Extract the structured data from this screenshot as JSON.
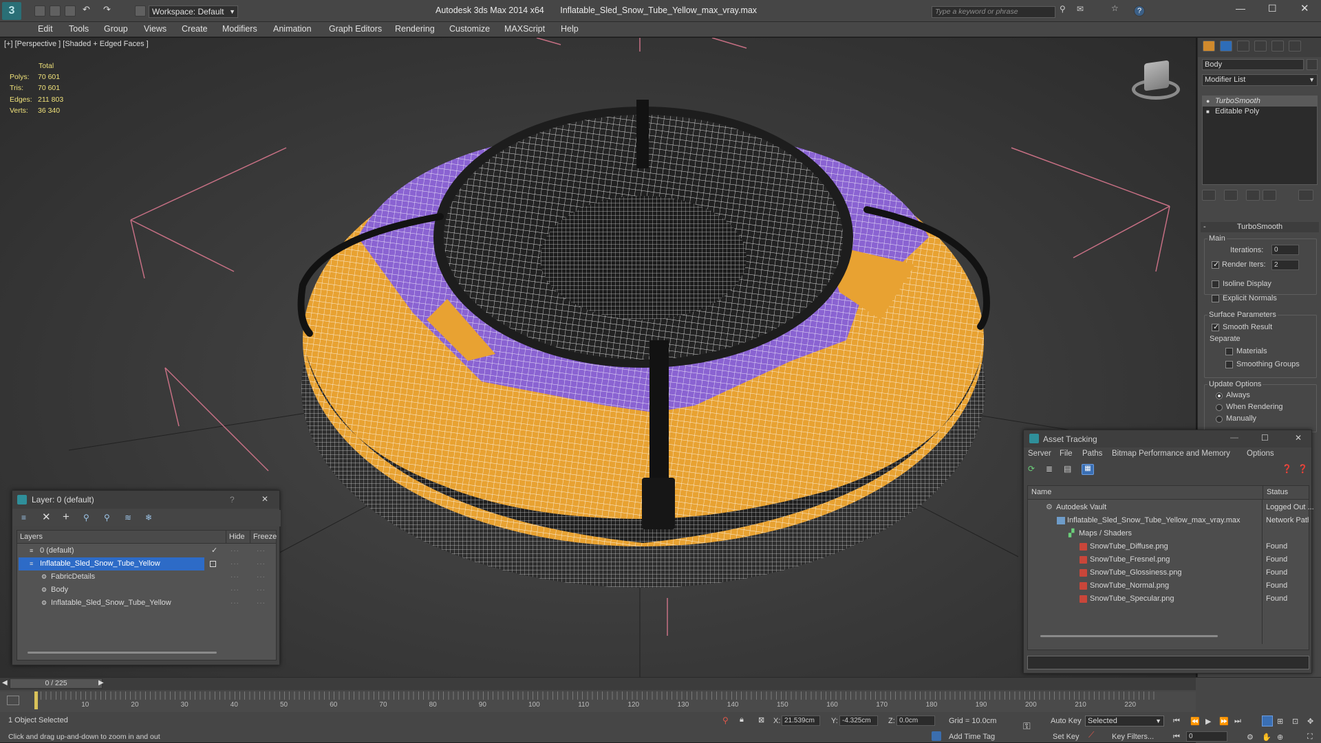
{
  "app": {
    "title": "Autodesk 3ds Max  2014 x64",
    "filename": "Inflatable_Sled_Snow_Tube_Yellow_max_vray.max",
    "workspace": "Workspace: Default",
    "search_placeholder": "Type a keyword or phrase"
  },
  "menu": [
    "Edit",
    "Tools",
    "Group",
    "Views",
    "Create",
    "Modifiers",
    "Animation",
    "Graph Editors",
    "Rendering",
    "Customize",
    "MAXScript",
    "Help"
  ],
  "viewport": {
    "label": "[+] [Perspective ] [Shaded + Edged Faces ]",
    "stats": {
      "header": "Total",
      "rows": [
        {
          "label": "Polys:",
          "value": "70 601"
        },
        {
          "label": "Tris:",
          "value": "70 601"
        },
        {
          "label": "Edges:",
          "value": "211 803"
        },
        {
          "label": "Verts:",
          "value": "36 340"
        }
      ]
    }
  },
  "command_panel": {
    "object_name": "Body",
    "modifier_list": "Modifier List",
    "stack": [
      "TurboSmooth",
      "Editable Poly"
    ],
    "rollout_title": "TurboSmooth",
    "main_label": "Main",
    "iterations_label": "Iterations:",
    "iterations_value": "0",
    "render_iters_label": "Render Iters:",
    "render_iters_value": "2",
    "isoline_label": "Isoline Display",
    "explicit_normals_label": "Explicit Normals",
    "surface_params_label": "Surface Parameters",
    "smooth_result_label": "Smooth Result",
    "separate_label": "Separate",
    "materials_label": "Materials",
    "smoothing_groups_label": "Smoothing Groups",
    "update_options_label": "Update Options",
    "update_options": [
      "Always",
      "When Rendering",
      "Manually"
    ]
  },
  "layer_window": {
    "title": "Layer: 0 (default)",
    "help": "?",
    "close": "✕",
    "col_layers": "Layers",
    "col_hide": "Hide",
    "col_freeze": "Freeze",
    "rows": [
      {
        "name": "0 (default)"
      },
      {
        "name": "Inflatable_Sled_Snow_Tube_Yellow"
      },
      {
        "name": "FabricDetails"
      },
      {
        "name": "Body"
      },
      {
        "name": "Inflatable_Sled_Snow_Tube_Yellow"
      }
    ]
  },
  "asset_window": {
    "title": "Asset Tracking",
    "menu": [
      "Server",
      "File",
      "Paths",
      "Bitmap Performance and Memory",
      "Options"
    ],
    "col_name": "Name",
    "col_status": "Status",
    "rows": [
      {
        "name": "Autodesk Vault",
        "status": "Logged Out ..."
      },
      {
        "name": "Inflatable_Sled_Snow_Tube_Yellow_max_vray.max",
        "status": "Network Path"
      },
      {
        "name": "Maps / Shaders",
        "status": ""
      },
      {
        "name": "SnowTube_Diffuse.png",
        "status": "Found"
      },
      {
        "name": "SnowTube_Fresnel.png",
        "status": "Found"
      },
      {
        "name": "SnowTube_Glossiness.png",
        "status": "Found"
      },
      {
        "name": "SnowTube_Normal.png",
        "status": "Found"
      },
      {
        "name": "SnowTube_Specular.png",
        "status": "Found"
      }
    ]
  },
  "timeline": {
    "frame": "0 / 225",
    "ticks": [
      "0",
      "10",
      "20",
      "30",
      "40",
      "50",
      "60",
      "70",
      "80",
      "90",
      "100",
      "110",
      "120",
      "130",
      "140",
      "150",
      "160",
      "170",
      "180",
      "190",
      "200",
      "210",
      "220"
    ],
    "status_selected": "1 Object Selected",
    "prompt": "Click and drag up-and-down to zoom in and out",
    "x_label": "X:",
    "x_value": "21.539cm",
    "y_label": "Y:",
    "y_value": "-4.325cm",
    "z_label": "Z:",
    "z_value": "0.0cm",
    "grid": "Grid = 10.0cm",
    "add_time_tag": "Add Time Tag",
    "auto_key": "Auto Key",
    "set_key": "Set Key",
    "selected_option": "Selected",
    "key_filters": "Key Filters...",
    "frame_field": "0"
  },
  "colors": {
    "accent": "#3a7bd5",
    "tube_orange": "#e8a232",
    "tube_purple": "#8a63d2",
    "selection": "#2d6bc7"
  }
}
